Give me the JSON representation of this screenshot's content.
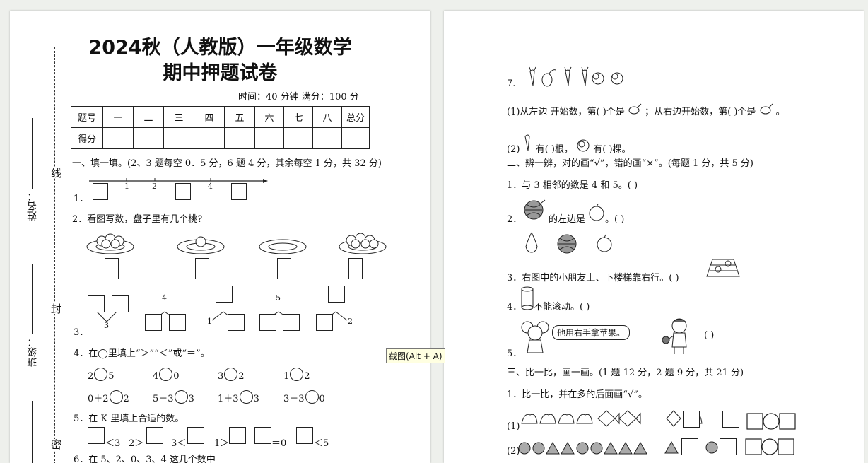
{
  "page1": {
    "title_line1": "2024秋（人教版）一年级数学",
    "title_line2": "期中押题试卷",
    "time_info": "时间：40 分钟    满分：100 分",
    "side_labels": {
      "name": "姓名：",
      "class": "班级："
    },
    "binding_labels": {
      "xian": "线",
      "feng": "封",
      "mi": "密"
    },
    "score_table": {
      "header": [
        "题号",
        "一",
        "二",
        "三",
        "四",
        "五",
        "六",
        "七",
        "八",
        "总分"
      ],
      "row_label": "得分"
    },
    "section1": "一、填一填。(2、3 题每空 0．5 分，6 题 4 分，其余每空 1 分，共 32 分)",
    "q1_num": "1．",
    "q1_ticks": [
      "1",
      "2",
      "4"
    ],
    "q2": "2．看图写数，盘子里有几个桃?",
    "q3_num": "3．",
    "q3_nums": [
      "3",
      "4",
      "1",
      "5",
      "2"
    ],
    "q4": "4．在◯里填上“＞”“＜”或“＝”。",
    "q4_row1": [
      "2",
      "5",
      "4",
      "0",
      "3",
      "2",
      "1",
      "2"
    ],
    "q4_row2": [
      "0＋2",
      "2",
      "5－3",
      "3",
      "1＋3",
      "3",
      "3－3",
      "0"
    ],
    "q5": "5．在 K 里填上合适的数。",
    "q5_items": [
      "＜3",
      "2＞",
      "3＜",
      "1＞",
      "＝0",
      "＜5"
    ],
    "q6_partial": "6．在 5、2、0、3、4 这几个数中"
  },
  "page2": {
    "q7_num": "7.",
    "q7_1a": "(1)从左边  开始数，第(       )个是",
    "q7_1b": "；从右边开始数，第(       )个是",
    "q7_1c": "。",
    "q7_2a": "(2)",
    "q7_2b": "有(      )根，",
    "q7_2c": "有(      )棵。",
    "section2": "二、辨一辨，对的画“√”，错的画“×”。(每题 1 分，共 5 分)",
    "s2_1": "1．与 3 相邻的数是 4 和 5。(      )",
    "s2_2a": "2．",
    "s2_2b": "的左边是",
    "s2_2c": "。(      )",
    "s2_3": "3．右图中的小朋友上、下楼梯靠右行。(       )",
    "s2_4a": "4．",
    "s2_4b": "不能滚动。(      )",
    "s2_5": "5．",
    "s2_5_speech": "他用右手拿苹果。",
    "s2_5_paren": "(         )",
    "section3": "三、比一比，画一画。(1 题 12 分，2 题 9 分，共 21 分)",
    "s3_1": "1．比一比，并在多的后面画“√”。",
    "s3_row1": "(1)",
    "s3_row2": "(2)"
  },
  "tooltip": "截图(Alt + A)"
}
